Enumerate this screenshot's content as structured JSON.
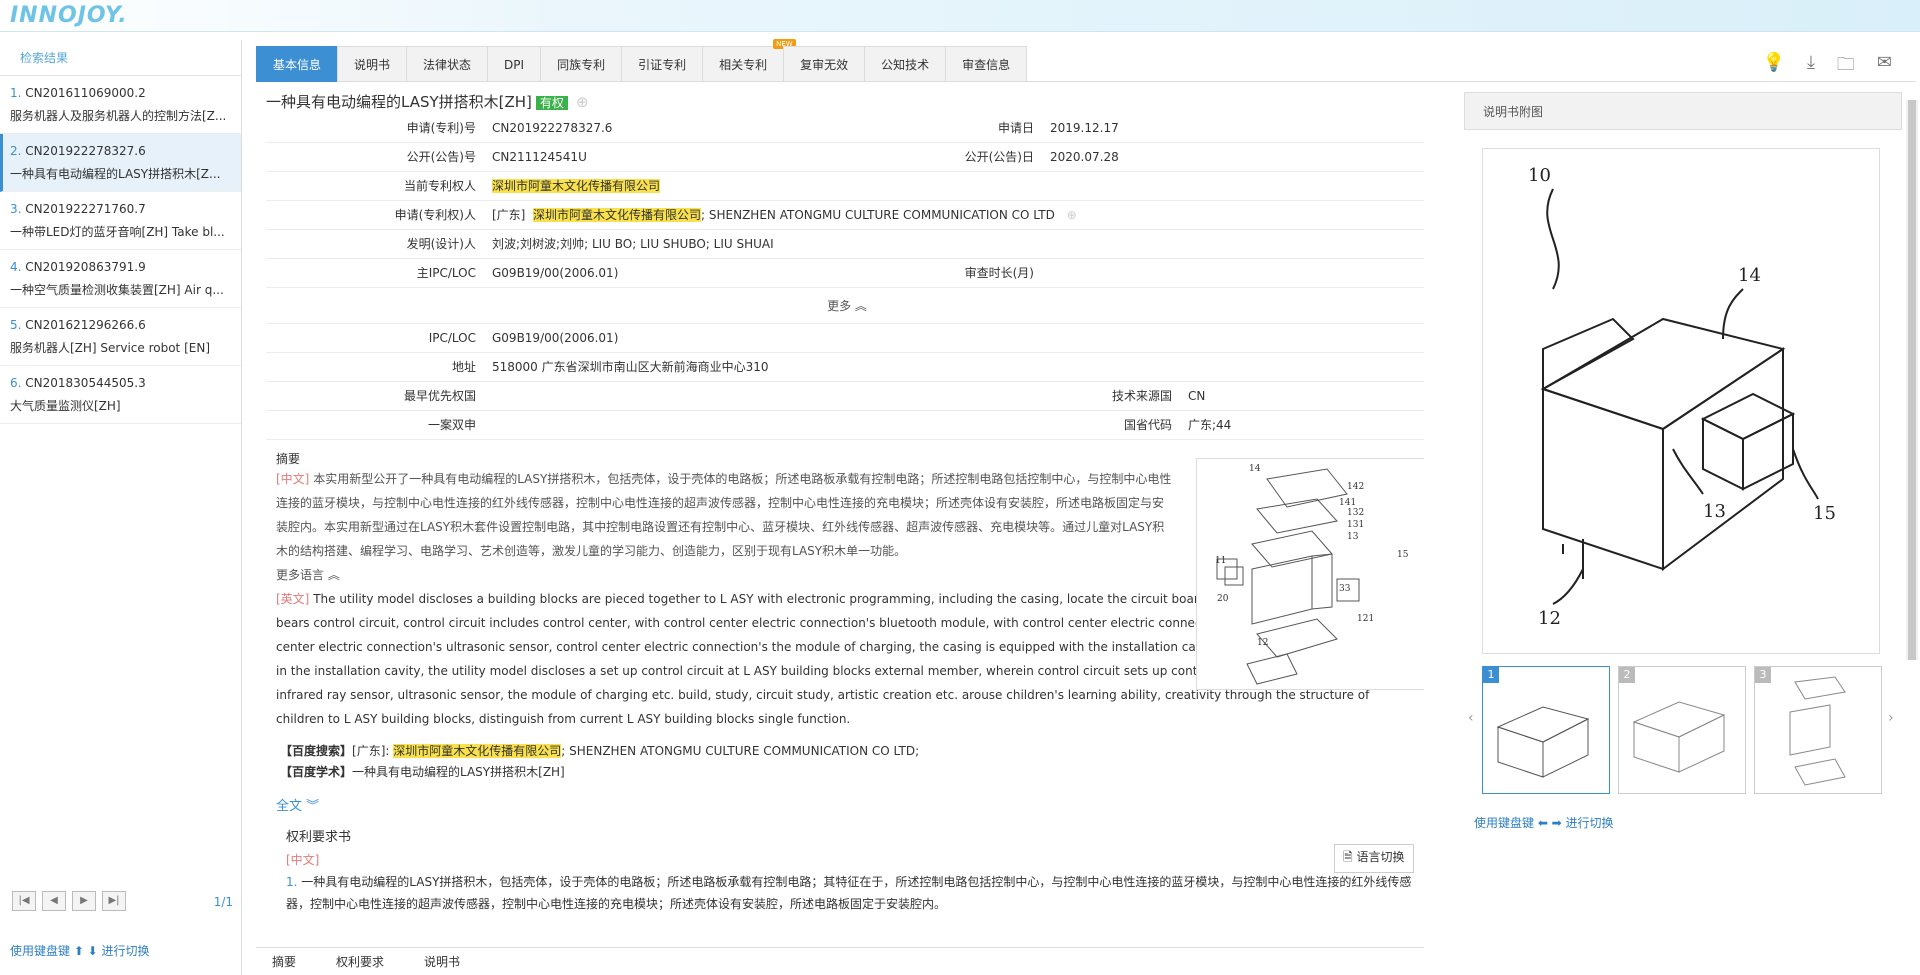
{
  "app": {
    "logo": "INNOJOY."
  },
  "sidebar": {
    "title": "检索结果",
    "items": [
      {
        "idx": "1.",
        "number": "CN201611069000.2",
        "title": "服务机器人及服务机器人的控制方法[Z..."
      },
      {
        "idx": "2.",
        "number": "CN201922278327.6",
        "title": "一种具有电动编程的LASY拼搭积木[Z..."
      },
      {
        "idx": "3.",
        "number": "CN201922271760.7",
        "title": "一种带LED灯的蓝牙音响[ZH] Take bl..."
      },
      {
        "idx": "4.",
        "number": "CN201920863791.9",
        "title": "一种空气质量检测收集装置[ZH] Air q..."
      },
      {
        "idx": "5.",
        "number": "CN201621296266.6",
        "title": "服务机器人[ZH] Service robot [EN]"
      },
      {
        "idx": "6.",
        "number": "CN201830544505.3",
        "title": "大气质量监测仪[ZH]"
      }
    ],
    "page_count": "1/1",
    "kbd_hint": "使用键盘键 ⬆ ⬇ 进行切换"
  },
  "tabs": [
    {
      "label": "基本信息"
    },
    {
      "label": "说明书"
    },
    {
      "label": "法律状态"
    },
    {
      "label": "DPI"
    },
    {
      "label": "同族专利"
    },
    {
      "label": "引证专利"
    },
    {
      "label": "相关专利"
    },
    {
      "label": "复审无效"
    },
    {
      "label": "公知技术"
    },
    {
      "label": "审查信息"
    }
  ],
  "new_badge": "NEW",
  "patent": {
    "title": "一种具有电动编程的LASY拼搭积木[ZH]",
    "status": "有权",
    "fields": {
      "app_no_label": "申请(专利)号",
      "app_no": "CN201922278327.6",
      "app_date_label": "申请日",
      "app_date": "2019.12.17",
      "pub_no_label": "公开(公告)号",
      "pub_no": "CN211124541U",
      "pub_date_label": "公开(公告)日",
      "pub_date": "2020.07.28",
      "owner_label": "当前专利权人",
      "owner": "深圳市阿童木文化传播有限公司",
      "applicant_label": "申请(专利权)人",
      "applicant_region": "[广东]",
      "applicant_cn": "深圳市阿童木文化传播有限公司",
      "applicant_en": "; SHENZHEN ATONGMU CULTURE COMMUNICATION CO LTD",
      "inventor_label": "发明(设计)人",
      "inventor": "刘波;刘树波;刘帅; LIU BO; LIU SHUBO; LIU SHUAI",
      "ipc_main_label": "主IPC/LOC",
      "ipc_main": "G09B19/00(2006.01)",
      "exam_label": "审查时长(月)",
      "more": "更多 ︽",
      "ipc_label": "IPC/LOC",
      "ipc": "G09B19/00(2006.01)",
      "address_label": "地址",
      "address": "518000 广东省深圳市南山区大新前海商业中心310",
      "priority_label": "最早优先权国",
      "tech_src_label": "技术来源国",
      "tech_src": "CN",
      "dual_label": "一案双申",
      "province_label": "国省代码",
      "province": "广东;44"
    },
    "abstract_title": "摘要",
    "abstract_cn_tag": "[中文]",
    "abstract_cn": "本实用新型公开了一种具有电动编程的LASY拼搭积木，包括壳体，设于壳体的电路板；所述电路板承载有控制电路；所述控制电路包括控制中心，与控制中心电性连接的蓝牙模块，与控制中心电性连接的红外线传感器，控制中心电性连接的超声波传感器，控制中心电性连接的充电模块；所述壳体设有安装腔，所述电路板固定与安装腔内。本实用新型通过在LASY积木套件设置控制电路，其中控制电路设置还有控制中心、蓝牙模块、红外线传感器、超声波传感器、充电模块等。通过儿童对LASY积木的结构搭建、编程学习、电路学习、艺术创造等，激发儿童的学习能力、创造能力，区别于现有LASY积木单一功能。",
    "more_lang": "更多语言 ︽",
    "abstract_en_tag": "[英文]",
    "abstract_en": "The utility model discloses a building blocks are pieced together to L ASY with electronic programming, including the casing, locate the circuit board of casing, the circuit board bears control circuit, control circuit includes control center, with control center electric connection's bluetooth module, with control center electric connection's infrared ray sensor, control center electric connection's ultrasonic sensor, control center electric connection's the module of charging, the casing is equipped with the installation cavity, the circuit board is fixed with in the installation cavity, the utility model discloses a set up control circuit at L ASY building blocks external member, wherein control circuit sets up control center, bluetooth module, infrared ray sensor, ultrasonic sensor, the module of charging etc. build, study, circuit study, artistic creation etc. arouse children's learning ability, creativity through the structure of children to L ASY building blocks, distinguish from current L ASY building blocks single function.",
    "baidu_search_label": "【百度搜索】",
    "baidu_search_region": "[广东]:",
    "baidu_search_cn": "深圳市阿童木文化传播有限公司",
    "baidu_search_en": "; SHENZHEN ATONGMU CULTURE COMMUNICATION CO LTD;",
    "baidu_scholar_label": "【百度学术】",
    "baidu_scholar": "一种具有电动编程的LASY拼搭积木[ZH]",
    "fulltext": "全文 ︾",
    "claims_title": "权利要求书",
    "lang_switch": "语言切换",
    "claims_tag": "[中文]",
    "claims_num": "1.",
    "claims_text": "一种具有电动编程的LASY拼搭积木，包括壳体，设于壳体的电路板；所述电路板承载有控制电路；其特征在于，所述控制电路包括控制中心，与控制中心电性连接的蓝牙模块，与控制中心电性连接的红外线传感器，控制中心电性连接的超声波传感器，控制中心电性连接的充电模块；所述壳体设有安装腔，所述电路板固定于安装腔内。"
  },
  "bottom_tabs": [
    {
      "label": "摘要"
    },
    {
      "label": "权利要求"
    },
    {
      "label": "说明书"
    }
  ],
  "right_panel": {
    "title": "说明书附图",
    "labels": [
      "10",
      "14",
      "15",
      "13",
      "12"
    ],
    "thumb_nums": [
      "1",
      "2",
      "3"
    ],
    "kbd_hint": "使用键盘键 ⬅ ➡ 进行切换",
    "fig_labels": [
      "14",
      "142",
      "141",
      "132",
      "131",
      "13",
      "15",
      "11",
      "33",
      "20",
      "121",
      "12"
    ]
  }
}
